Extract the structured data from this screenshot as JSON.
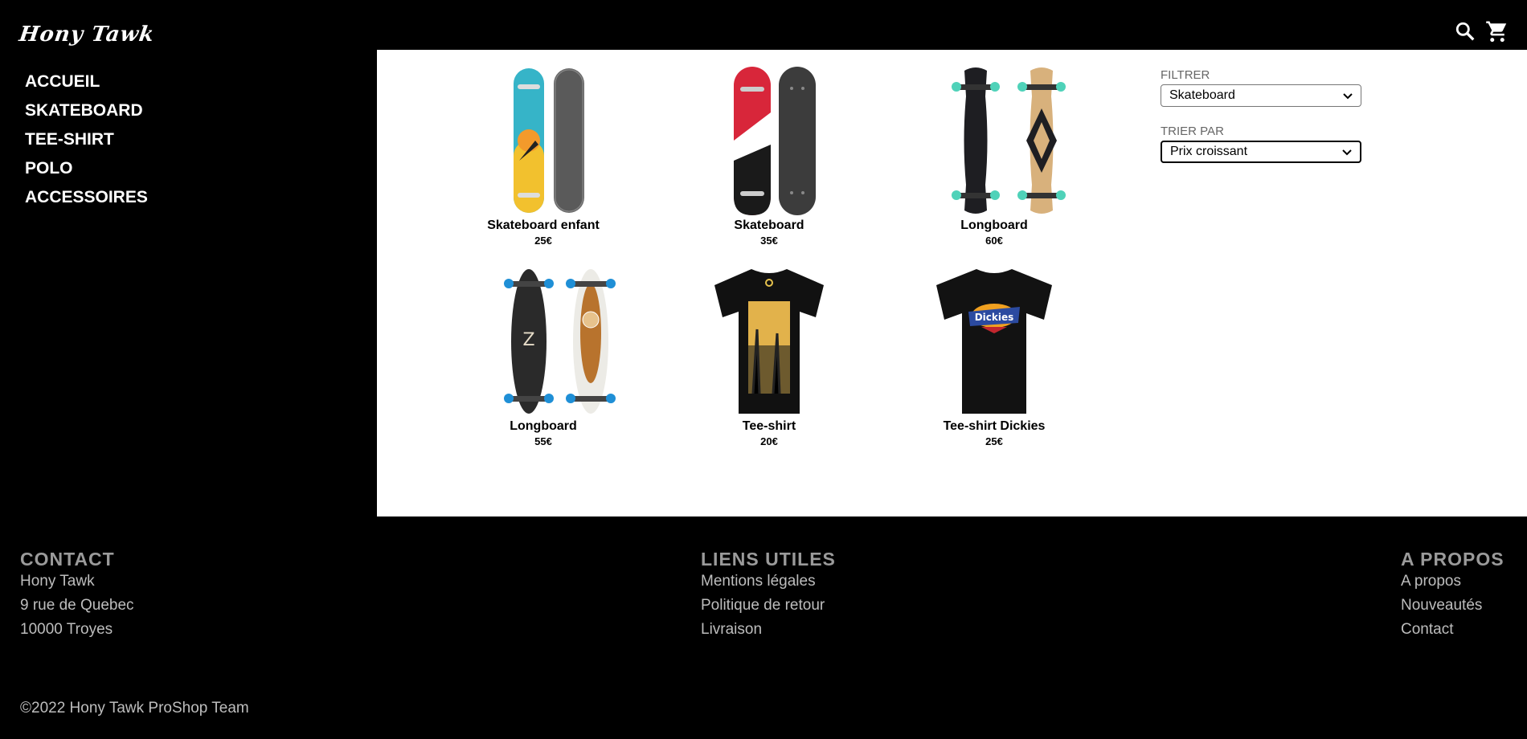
{
  "header": {
    "logo_text": "Hony Tawk",
    "search_icon": "search-icon",
    "cart_icon": "cart-icon"
  },
  "nav": [
    {
      "label": "ACCUEIL"
    },
    {
      "label": "SKATEBOARD"
    },
    {
      "label": "TEE-SHIRT"
    },
    {
      "label": "POLO"
    },
    {
      "label": "ACCESSOIRES"
    }
  ],
  "products": [
    {
      "name": "Skateboard enfant",
      "price": "25€"
    },
    {
      "name": "Skateboard",
      "price": "35€"
    },
    {
      "name": "Longboard",
      "price": "60€"
    },
    {
      "name": "Longboard",
      "price": "55€"
    },
    {
      "name": "Tee-shirt",
      "price": "20€"
    },
    {
      "name": "Tee-shirt Dickies",
      "price": "25€"
    }
  ],
  "filters": {
    "filter_label": "FILTRER",
    "filter_value": "Skateboard",
    "sort_label": "TRIER PAR",
    "sort_value": "Prix croissant"
  },
  "footer": {
    "contact": {
      "title": "CONTACT",
      "lines": [
        "Hony Tawk",
        "9 rue de Quebec",
        "10000 Troyes"
      ]
    },
    "links": {
      "title": "LIENS UTILES",
      "items": [
        "Mentions légales",
        "Politique de retour",
        "Livraison"
      ]
    },
    "about": {
      "title": "A PROPOS",
      "items": [
        "A propos",
        "Nouveautés",
        "Contact"
      ]
    },
    "copyright": "©2022 Hony Tawk ProShop Team"
  }
}
